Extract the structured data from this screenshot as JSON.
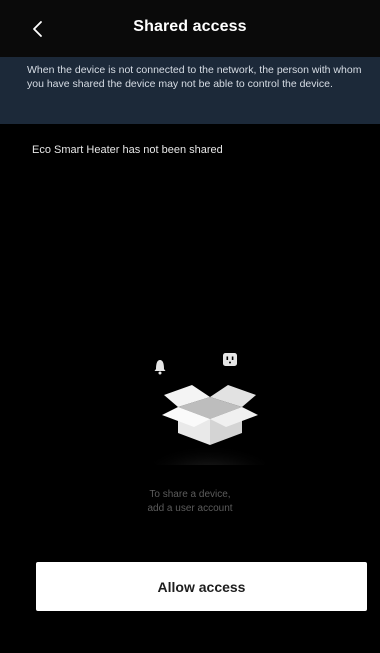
{
  "header": {
    "title": "Shared access",
    "back_icon": "chevron-left-icon"
  },
  "notice": {
    "text": "When the device is not connected to the network, the person with whom you have shared the device may not be able to control the device."
  },
  "status": {
    "text": "Eco Smart Heater has not been shared"
  },
  "empty_state": {
    "line1": "To share a device,",
    "line2": "add a user account"
  },
  "actions": {
    "allow_access_label": "Allow access"
  },
  "colors": {
    "background": "#000000",
    "notice_background": "#1c2939",
    "button_background": "#ffffff"
  }
}
